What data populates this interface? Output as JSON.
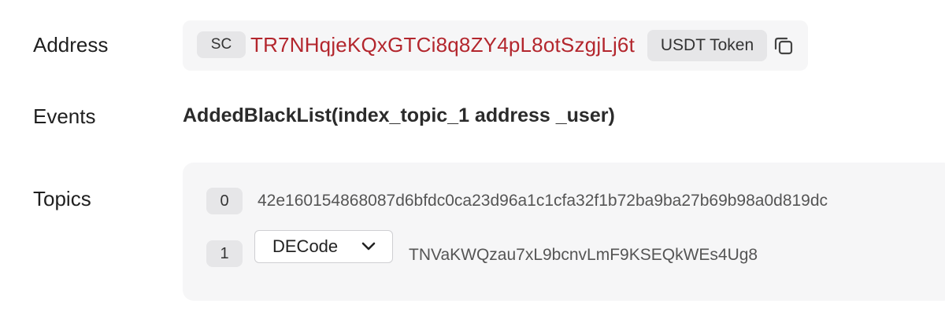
{
  "labels": {
    "address": "Address",
    "events": "Events",
    "topics": "Topics"
  },
  "address": {
    "type_badge": "SC",
    "value": "TR7NHqjeKQxGTCi8q8ZY4pL8otSzgjLj6t",
    "token_label": "USDT Token",
    "copy_icon": "copy-icon",
    "value_color": "#b3262d"
  },
  "event": {
    "signature": "AddedBlackList(index_topic_1 address _user)"
  },
  "topics": [
    {
      "index": "0",
      "value": "42e160154868087d6bfdc0ca23d96a1c1cfa32f1b72ba9ba27b69b98a0d819dc"
    },
    {
      "index": "1",
      "decode_selected": "DECode",
      "decode_icon": "chevron-down-icon",
      "value": "TNVaKWQzau7xL9bcnvLmF9KSEQkWEs4Ug8"
    }
  ]
}
